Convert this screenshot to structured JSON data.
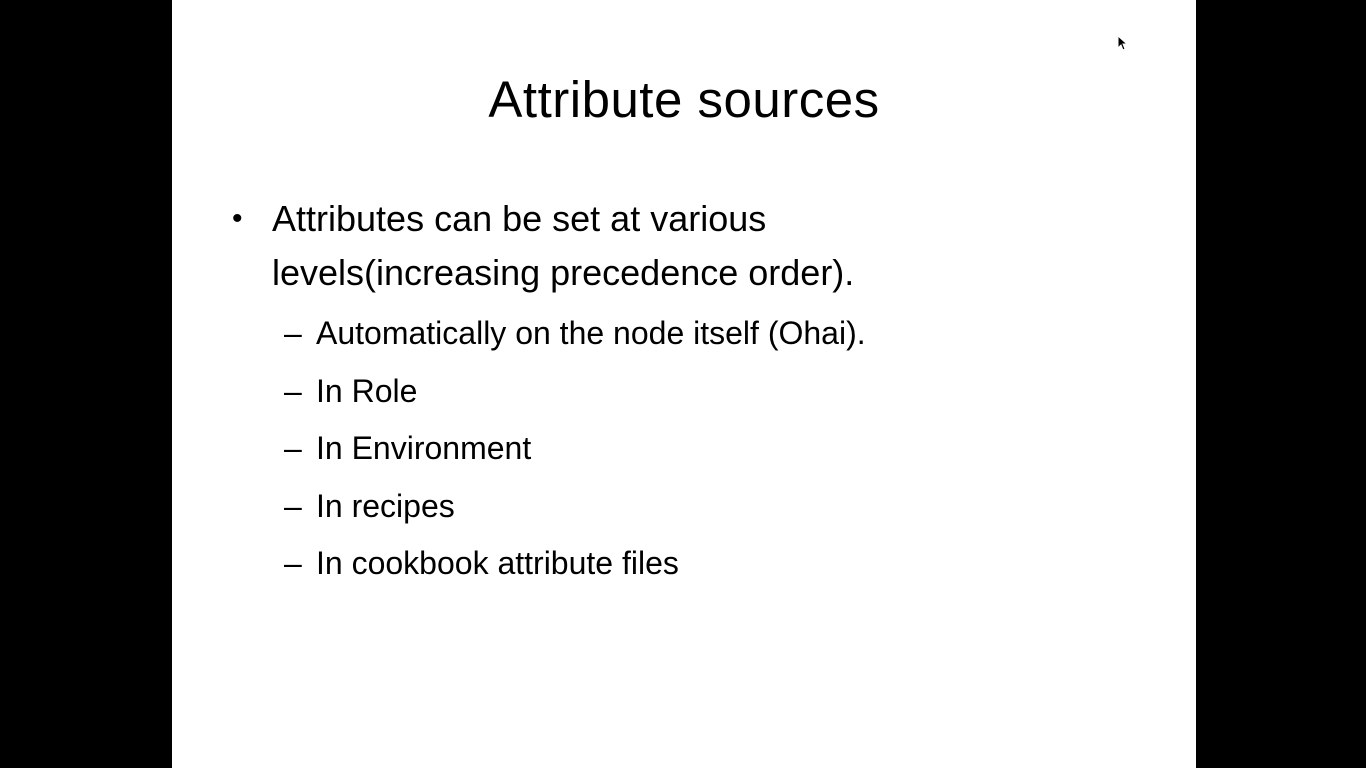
{
  "slide": {
    "title": "Attribute sources",
    "main_bullet": {
      "marker": "•",
      "text": "Attributes can be set at various levels(increasing precedence order)."
    },
    "sub_items": [
      {
        "marker": "–",
        "text": "Automatically on the node itself (Ohai)."
      },
      {
        "marker": "–",
        "text": "In Role"
      },
      {
        "marker": "–",
        "text": "In Environment"
      },
      {
        "marker": "–",
        "text": "In recipes"
      },
      {
        "marker": "–",
        "text": "In cookbook attribute files"
      }
    ]
  },
  "cursor": {
    "icon": "mouse-pointer-icon"
  },
  "colors": {
    "background": "#000000",
    "slide": "#ffffff",
    "text": "#000000"
  }
}
